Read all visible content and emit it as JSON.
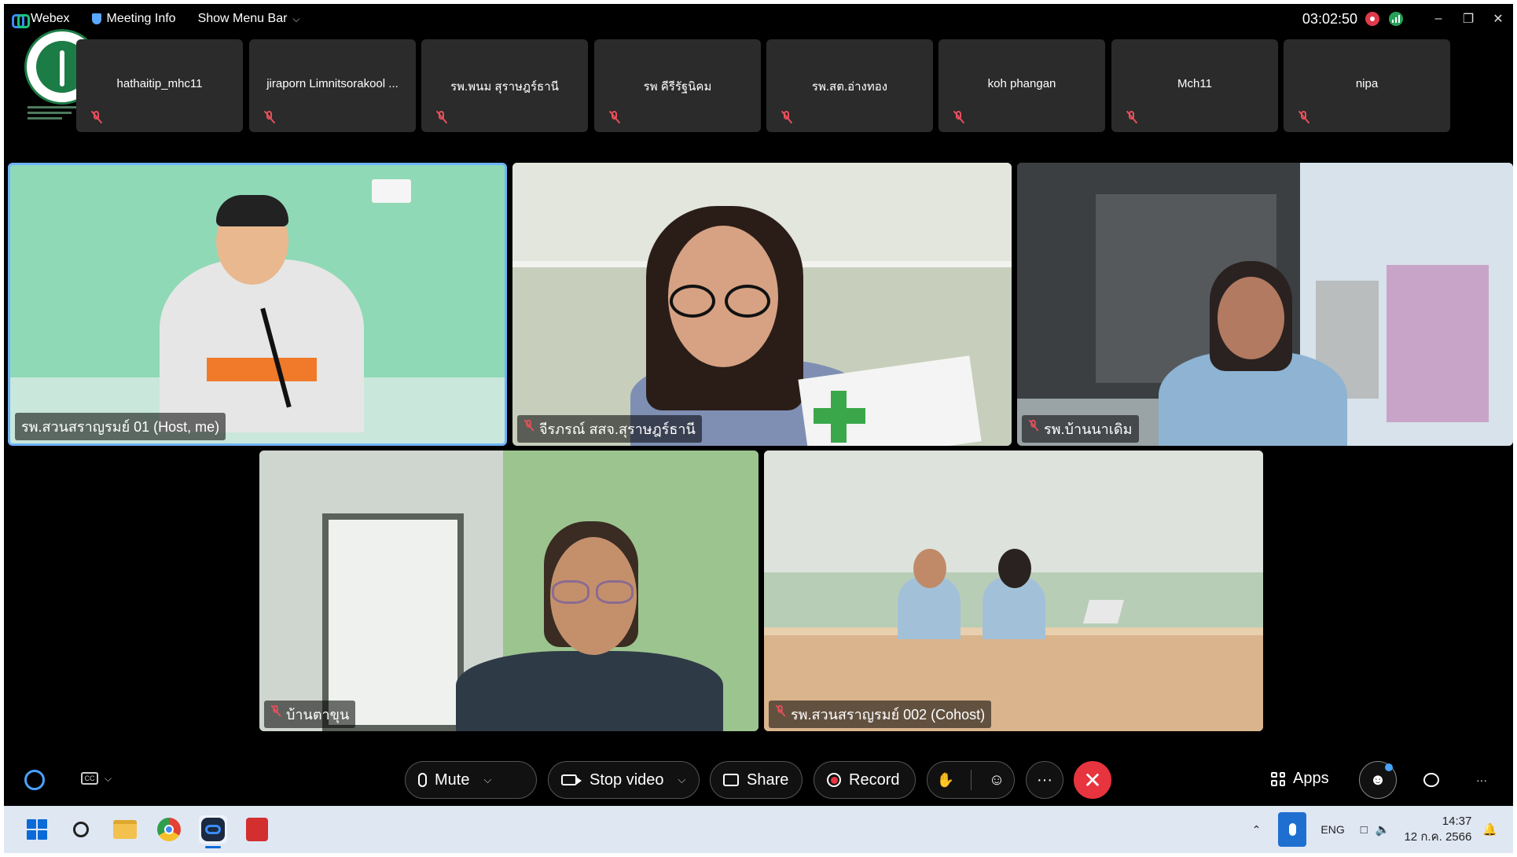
{
  "titlebar": {
    "app_name": "Webex",
    "meeting_info": "Meeting Info",
    "show_menu_bar": "Show Menu Bar",
    "timer": "03:02:50"
  },
  "strip": [
    {
      "name": "hathaitip_mhc11"
    },
    {
      "name": "jiraporn Limnitsorakool ..."
    },
    {
      "name": "รพ.พนม สุราษฎร์ธานี"
    },
    {
      "name": "รพ คีรีรัฐนิคม"
    },
    {
      "name": "รพ.สต.อ่างทอง"
    },
    {
      "name": "koh phangan"
    },
    {
      "name": "Mch11"
    },
    {
      "name": "nipa"
    }
  ],
  "videos": [
    {
      "name": "รพ.สวนสราญรมย์ 01 (Host, me)"
    },
    {
      "name": "จีรภรณ์ สสจ.สุราษฎร์ธานี"
    },
    {
      "name": "รพ.บ้านนาเดิม"
    },
    {
      "name": "บ้านตาขุน"
    },
    {
      "name": "รพ.สวนสราญรมย์ 002 (Cohost)"
    }
  ],
  "controls": {
    "mute": "Mute",
    "stop_video": "Stop video",
    "share": "Share",
    "record": "Record",
    "apps": "Apps",
    "more": "···",
    "end": "✕"
  },
  "taskbar": {
    "language": "ENG",
    "time": "14:37",
    "date": "12 ก.ค. 2566"
  },
  "colors": {
    "accent": "#6fb4ff",
    "end_call": "#e8343f",
    "muted": "#e8505b",
    "strip_tile": "#2b2b2b"
  }
}
